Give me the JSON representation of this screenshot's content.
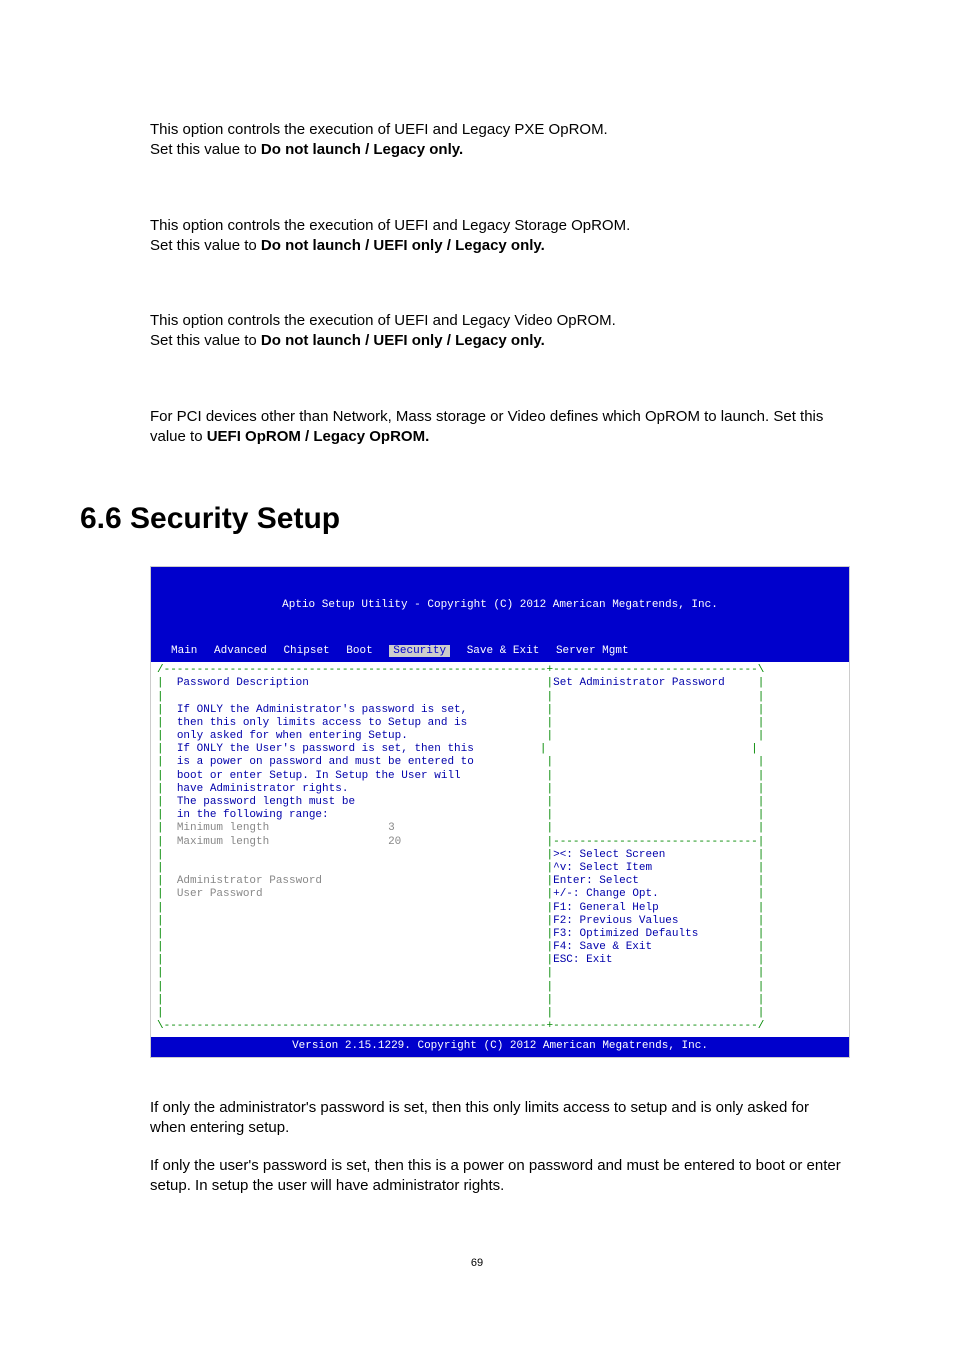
{
  "p1": {
    "line1": "This option controls the execution of UEFI and Legacy PXE OpROM.",
    "prefix": "Set this value to ",
    "bold": "Do not launch / Legacy only."
  },
  "p2": {
    "line1": "This option controls the execution of UEFI and Legacy Storage OpROM.",
    "prefix": "Set this value to ",
    "bold": "Do not launch / UEFI only / Legacy only."
  },
  "p3": {
    "line1": "This option controls the execution of UEFI and Legacy Video OpROM.",
    "prefix": "Set this value to ",
    "bold": "Do not launch / UEFI only / Legacy only."
  },
  "p4": {
    "line1": "For PCI devices other than Network, Mass storage or Video defines which OpROM to launch. Set this value to ",
    "bold": "UEFI OpROM / Legacy OpROM."
  },
  "heading": "6.6  Security Setup",
  "bios": {
    "title": "Aptio Setup Utility - Copyright (C) 2012 American Megatrends, Inc.",
    "tabs": [
      "Main",
      "Advanced",
      "Chipset",
      "Boot",
      "Security",
      "Save & Exit",
      "Server Mgmt"
    ],
    "left": {
      "pd": "Password Description",
      "l1": "If ONLY the Administrator's password is set,",
      "l2": "then this only limits access to Setup and is",
      "l3": "only asked for when entering Setup.",
      "l4": "If ONLY the User's password is set, then this",
      "l5": "is a power on password and must be entered to",
      "l6": "boot or enter Setup. In Setup the User will",
      "l7": "have Administrator rights.",
      "l8": "The password length must be",
      "l9": "in the following range:",
      "min_label": "Minimum length",
      "min_val": "3",
      "max_label": "Maximum length",
      "max_val": "20",
      "admin": "Administrator Password",
      "user": "User Password"
    },
    "right": {
      "help": "Set Administrator Password",
      "k1": "><: Select Screen",
      "k2": "^v: Select Item",
      "k3": "Enter: Select",
      "k4": "+/-: Change Opt.",
      "k5": "F1: General Help",
      "k6": "F2: Previous Values",
      "k7": "F3: Optimized Defaults",
      "k8": "F4: Save & Exit",
      "k9": "ESC: Exit"
    },
    "footer": "Version 2.15.1229. Copyright (C) 2012 American Megatrends, Inc."
  },
  "after1": "If only the administrator's password is set, then this only limits access to setup and is only asked for when entering setup.",
  "after2": "If only the user's password is set, then this is a power on password and must be entered to boot or enter setup. In setup the user will have administrator rights.",
  "pagenum": "69"
}
